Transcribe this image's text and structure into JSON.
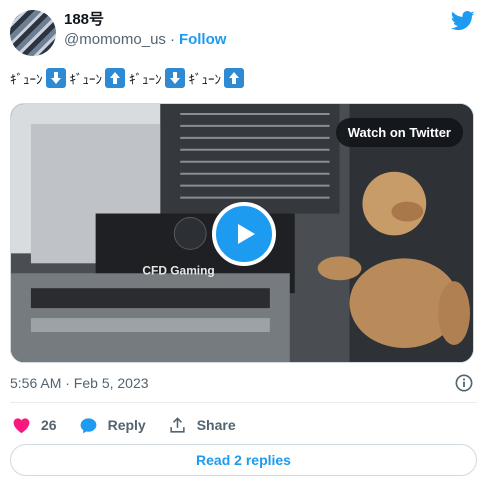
{
  "author": {
    "name": "188号",
    "handle": "@momomo_us",
    "separator": "·",
    "follow_label": "Follow"
  },
  "tweet": {
    "parts": [
      "ｷﾞｭｰﾝ",
      "ｷﾞｭｰﾝ",
      "ｷﾞｭｰﾝ",
      "ｷﾞｭｰﾝ"
    ],
    "arrows": [
      "down",
      "up",
      "down",
      "up"
    ]
  },
  "media": {
    "overlay_label": "Watch on Twitter",
    "product_logo": "CFD Gaming"
  },
  "timestamp": "5:56 AM · Feb 5, 2023",
  "actions": {
    "likes": "26",
    "reply_label": "Reply",
    "share_label": "Share"
  },
  "replies_button": "Read 2 replies",
  "colors": {
    "accent": "#1d9bf0",
    "heart": "#f91880",
    "arrow_emoji": "#2d8ad3",
    "text": "#0f1419",
    "muted": "#536471"
  }
}
